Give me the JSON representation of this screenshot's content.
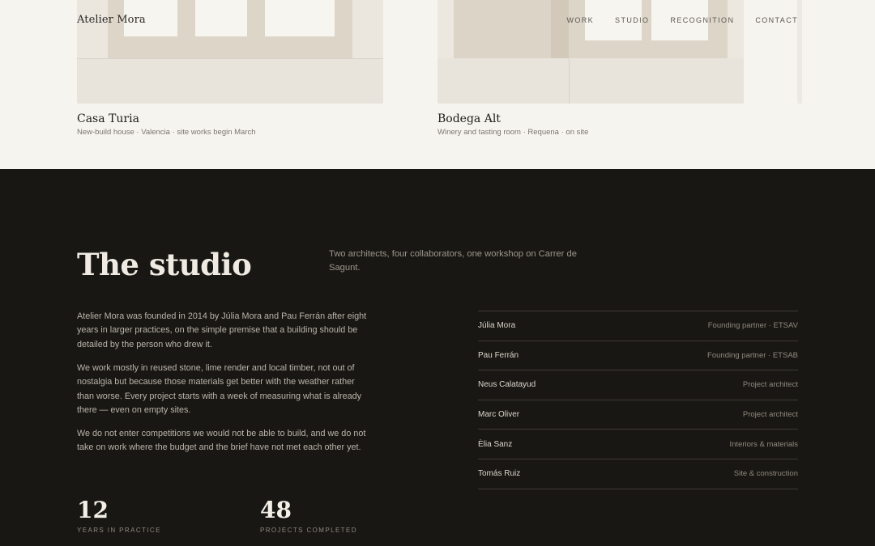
{
  "header": {
    "logo": "Atelier Mora",
    "nav": [
      {
        "label": "WORK"
      },
      {
        "label": "STUDIO"
      },
      {
        "label": "RECOGNITION"
      },
      {
        "label": "CONTACT"
      }
    ]
  },
  "projects": [
    {
      "title": "Casa Turia",
      "meta": "New-build house · Valencia · site works begin March"
    },
    {
      "title": "Bodega Alt",
      "meta": "Winery and tasting room · Requena · on site"
    }
  ],
  "studio": {
    "heading": "The studio",
    "lede": "Two architects, four collaborators, one workshop on Carrer de Sagunt.",
    "paragraphs": [
      "Atelier Mora was founded in 2014 by Júlia Mora and Pau Ferrán after eight years in larger practices, on the simple premise that a building should be detailed by the person who drew it.",
      "We work mostly in reused stone, lime render and local timber, not out of nostalgia but because those materials get better with the weather rather than worse. Every project starts with a week of measuring what is already there — even on empty sites.",
      "We do not enter competitions we would not be able to build, and we do not take on work where the budget and the brief have not met each other yet."
    ],
    "stats": [
      {
        "value": "12",
        "label": "YEARS IN PRACTICE"
      },
      {
        "value": "48",
        "label": "PROJECTS COMPLETED"
      }
    ],
    "team": [
      {
        "name": "Júlia Mora",
        "role": "Founding partner · ETSAV"
      },
      {
        "name": "Pau Ferrán",
        "role": "Founding partner · ETSAB"
      },
      {
        "name": "Neus Calatayud",
        "role": "Project architect"
      },
      {
        "name": "Marc Oliver",
        "role": "Project architect"
      },
      {
        "name": "Èlia Sanz",
        "role": "Interiors & materials"
      },
      {
        "name": "Tomás Ruiz",
        "role": "Site & construction"
      }
    ]
  }
}
